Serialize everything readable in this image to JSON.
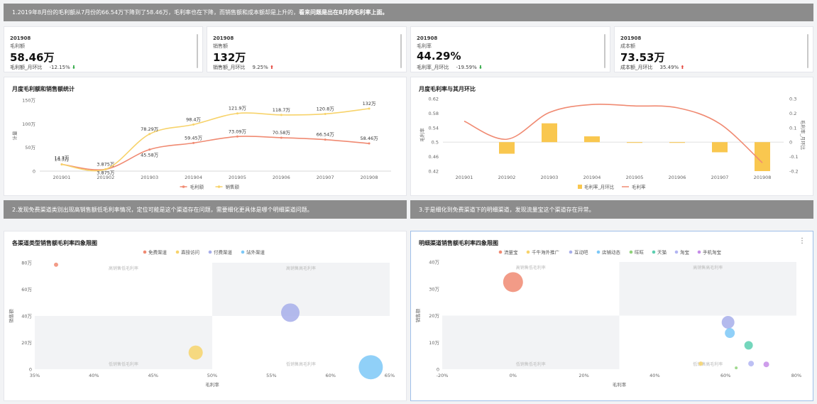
{
  "banners": {
    "top": {
      "text": "1.2019年8月份的毛利额从7月份的66.54万下降到了58.46万，毛利率也在下降，而销售额和成本额却是上升的，",
      "bold": "看来问题是出在8月的毛利率上面。"
    },
    "left": {
      "text": "2.发现免费渠道类别出现高销售额低毛利率情况，定位可能是这个渠道存在问题，需要细化更具体是哪个明细渠道问题。"
    },
    "right": {
      "text": "3.于是细化到免费渠道下的明细渠道，发现流量宝这个渠道存在异常。"
    }
  },
  "kpis": [
    {
      "period": "201908",
      "name": "毛利额",
      "value": "58.46万",
      "cmp_label": "毛利额_月环比",
      "cmp_value": "-12.15%",
      "dir": "down"
    },
    {
      "period": "201908",
      "name": "销售额",
      "value": "132万",
      "cmp_label": "销售额_月环比",
      "cmp_value": "9.25%",
      "dir": "up"
    },
    {
      "period": "201908",
      "name": "毛利率",
      "value": "44.29%",
      "cmp_label": "毛利率_月环比",
      "cmp_value": "-19.59%",
      "dir": "down"
    },
    {
      "period": "201908",
      "name": "成本额",
      "value": "73.53万",
      "cmp_label": "成本额_月环比",
      "cmp_value": "35.49%",
      "dir": "up"
    }
  ],
  "colors": {
    "profit": "#f08a72",
    "sales": "#f7d36b",
    "bar": "#f9c74f",
    "grey": "#f2f3f5"
  },
  "chart_data": [
    {
      "type": "line",
      "title": "月度毛利额和销售额统计",
      "ylabel": "计量",
      "ylim": [
        0,
        150
      ],
      "yticks": [
        "0",
        "50万",
        "100万",
        "150万"
      ],
      "categories": [
        "201901",
        "201902",
        "201903",
        "201904",
        "201905",
        "201906",
        "201907",
        "201908"
      ],
      "series": [
        {
          "name": "毛利额",
          "values": [
            14.3,
            3.875,
            45.58,
            59.45,
            73.09,
            70.58,
            66.54,
            58.46
          ],
          "labels": [
            "14.3万",
            "3.875万",
            "45.58万",
            "59.45万",
            "73.09万",
            "70.58万",
            "66.54万",
            "58.46万"
          ],
          "label_at": [
            null,
            null,
            "below",
            "above",
            "above",
            "above",
            "above",
            "above"
          ]
        },
        {
          "name": "销售额",
          "values": [
            14.3,
            3.875,
            78.29,
            98.4,
            121.9,
            118.7,
            120.8,
            132
          ],
          "labels": [
            "",
            "",
            "78.29万",
            "98.4万",
            "121.9万",
            "118.7万",
            "120.8万",
            "132万"
          ],
          "label_at": [
            null,
            null,
            "above",
            "above",
            "above",
            "above",
            "above",
            "above"
          ]
        }
      ],
      "extra_labels": [
        {
          "category": "201901",
          "value": 14.3,
          "text": "14.3万"
        },
        {
          "category": "201902",
          "value": 3.875,
          "text": "3.875万"
        }
      ],
      "legend": "bottom"
    },
    {
      "type": "bar",
      "title": "月度毛利率与其月环比",
      "ylabel": "毛利率",
      "y2label": "毛利率_月环比",
      "categories": [
        "201901",
        "201902",
        "201903",
        "201904",
        "201905",
        "201906",
        "201907",
        "201908"
      ],
      "ylim": [
        0.42,
        0.62
      ],
      "yticks": [
        "0.42",
        "0.46",
        "0.5",
        "0.54",
        "0.58",
        "0.62"
      ],
      "y2lim": [
        -0.2,
        0.3
      ],
      "y2ticks": [
        "-0.2",
        "-0.1",
        "0",
        "0.1",
        "0.2",
        "0.3"
      ],
      "series": [
        {
          "name": "毛利率_月环比",
          "axis": "right",
          "values": [
            0,
            -0.08,
            0.13,
            0.04,
            -0.005,
            -0.005,
            -0.07,
            -0.2
          ]
        },
        {
          "name": "毛利率",
          "axis": "left",
          "values": [
            0.558,
            0.508,
            0.582,
            0.604,
            0.6,
            0.595,
            0.551,
            0.443
          ]
        }
      ],
      "legend": "bottom"
    },
    {
      "type": "scatter",
      "title": "各渠道类型销售额毛利率四象限图",
      "xlabel": "毛利率",
      "ylabel": "销售额",
      "xlim": [
        35,
        65
      ],
      "ylim": [
        0,
        80
      ],
      "xticks": [
        "35%",
        "40%",
        "45%",
        "50%",
        "55%",
        "60%",
        "65%"
      ],
      "yticks": [
        "0",
        "20万",
        "40万",
        "60万",
        "80万"
      ],
      "quadrants": [
        "高销售低毛利率",
        "高销售高毛利率",
        "低销售低毛利率",
        "低销售高毛利率"
      ],
      "split": {
        "x": 50,
        "y": 40
      },
      "series": [
        {
          "name": "免费渠道",
          "color": "#f08a72",
          "points": [
            {
              "x": 36.8,
              "y": 78.5,
              "size": 3
            }
          ]
        },
        {
          "name": "直接访问",
          "color": "#f7d36b",
          "points": [
            {
              "x": 48.6,
              "y": 12.5,
              "size": 10
            }
          ]
        },
        {
          "name": "付费渠道",
          "color": "#a7aeea",
          "points": [
            {
              "x": 56.6,
              "y": 42.5,
              "size": 13
            }
          ]
        },
        {
          "name": "站外渠道",
          "color": "#7cc8f7",
          "points": [
            {
              "x": 63.4,
              "y": 1.5,
              "size": 17
            }
          ]
        }
      ],
      "legend": "top"
    },
    {
      "type": "scatter",
      "title": "明细渠道销售额毛利率四象限图",
      "xlabel": "毛利率",
      "ylabel": "销售额",
      "xlim": [
        -20,
        80
      ],
      "ylim": [
        0,
        40
      ],
      "xticks": [
        "-20%",
        "0%",
        "20%",
        "40%",
        "60%",
        "80%"
      ],
      "yticks": [
        "0",
        "10万",
        "20万",
        "30万",
        "40万"
      ],
      "quadrants": [
        "高销售低毛利率",
        "高销售高毛利率",
        "低销售低毛利率",
        "低销售高毛利率"
      ],
      "split": {
        "x": 30,
        "y": 20
      },
      "series": [
        {
          "name": "流量宝",
          "color": "#f08a72",
          "points": [
            {
              "x": 0,
              "y": 32.5,
              "size": 14
            }
          ]
        },
        {
          "name": "千牛海外推广",
          "color": "#f7d36b",
          "points": [
            {
              "x": 53,
              "y": 2.1,
              "size": 3
            }
          ]
        },
        {
          "name": "互动吧",
          "color": "#a7aeea",
          "points": [
            {
              "x": 60.7,
              "y": 17.5,
              "size": 9
            }
          ]
        },
        {
          "name": "店铺动态",
          "color": "#7cc8f7",
          "points": [
            {
              "x": 61.2,
              "y": 13.5,
              "size": 7
            }
          ]
        },
        {
          "name": "旺旺",
          "color": "#8fd27a",
          "points": [
            {
              "x": 63,
              "y": 0.5,
              "size": 2
            }
          ]
        },
        {
          "name": "天猫",
          "color": "#5ccfb0",
          "points": [
            {
              "x": 66.5,
              "y": 8.9,
              "size": 6
            }
          ]
        },
        {
          "name": "淘宝",
          "color": "#b2b5f2",
          "points": [
            {
              "x": 67.2,
              "y": 2.1,
              "size": 4
            }
          ]
        },
        {
          "name": "手机淘宝",
          "color": "#c58ce8",
          "points": [
            {
              "x": 71.5,
              "y": 1.8,
              "size": 4
            }
          ]
        }
      ],
      "legend": "top"
    }
  ]
}
